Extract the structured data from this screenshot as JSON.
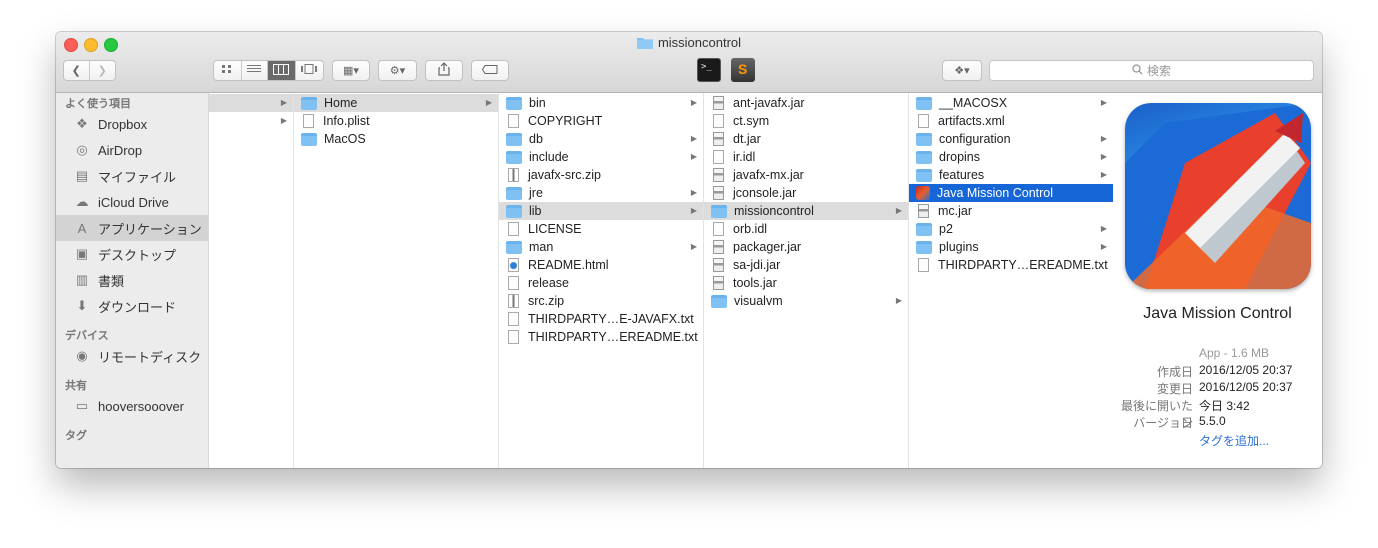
{
  "window": {
    "title": "missioncontrol"
  },
  "toolbar": {
    "search_placeholder": "検索",
    "back_icon": "chevron-left-icon",
    "forward_icon": "chevron-right-icon"
  },
  "sidebar": {
    "sections": [
      {
        "heading": "よく使う項目",
        "items": [
          {
            "label": "Dropbox",
            "icon": "dropbox-icon"
          },
          {
            "label": "AirDrop",
            "icon": "airdrop-icon"
          },
          {
            "label": "マイファイル",
            "icon": "all-files-icon"
          },
          {
            "label": "iCloud Drive",
            "icon": "cloud-icon"
          },
          {
            "label": "アプリケーション",
            "icon": "applications-icon",
            "selected": true
          },
          {
            "label": "デスクトップ",
            "icon": "desktop-icon"
          },
          {
            "label": "書類",
            "icon": "documents-icon"
          },
          {
            "label": "ダウンロード",
            "icon": "downloads-icon"
          }
        ]
      },
      {
        "heading": "デバイス",
        "items": [
          {
            "label": "リモートディスク",
            "icon": "disc-icon"
          }
        ]
      },
      {
        "heading": "共有",
        "items": [
          {
            "label": "hooversooover",
            "icon": "computer-icon"
          }
        ]
      },
      {
        "heading": "タグ",
        "items": []
      }
    ]
  },
  "columns": [
    {
      "items": [
        {
          "label": "",
          "type": "blank",
          "arrow": true,
          "path": true
        },
        {
          "label": "",
          "type": "blank",
          "arrow": true
        }
      ]
    },
    {
      "items": [
        {
          "label": "Home",
          "type": "folder",
          "arrow": true,
          "path": true
        },
        {
          "label": "Info.plist",
          "type": "file"
        },
        {
          "label": "MacOS",
          "type": "folder"
        }
      ]
    },
    {
      "items": [
        {
          "label": "bin",
          "type": "folder",
          "arrow": true
        },
        {
          "label": "COPYRIGHT",
          "type": "blank"
        },
        {
          "label": "db",
          "type": "folder",
          "arrow": true
        },
        {
          "label": "include",
          "type": "folder",
          "arrow": true
        },
        {
          "label": "javafx-src.zip",
          "type": "zip"
        },
        {
          "label": "jre",
          "type": "folder",
          "arrow": true
        },
        {
          "label": "lib",
          "type": "folder",
          "arrow": true,
          "path": true
        },
        {
          "label": "LICENSE",
          "type": "blank"
        },
        {
          "label": "man",
          "type": "folder",
          "arrow": true
        },
        {
          "label": "README.html",
          "type": "html"
        },
        {
          "label": "release",
          "type": "file"
        },
        {
          "label": "src.zip",
          "type": "zip"
        },
        {
          "label": "THIRDPARTY…E-JAVAFX.txt",
          "type": "file"
        },
        {
          "label": "THIRDPARTY…EREADME.txt",
          "type": "file"
        }
      ]
    },
    {
      "items": [
        {
          "label": "ant-javafx.jar",
          "type": "jar"
        },
        {
          "label": "ct.sym",
          "type": "blank"
        },
        {
          "label": "dt.jar",
          "type": "jar"
        },
        {
          "label": "ir.idl",
          "type": "file"
        },
        {
          "label": "javafx-mx.jar",
          "type": "jar"
        },
        {
          "label": "jconsole.jar",
          "type": "jar"
        },
        {
          "label": "missioncontrol",
          "type": "folder",
          "arrow": true,
          "path": true
        },
        {
          "label": "orb.idl",
          "type": "file"
        },
        {
          "label": "packager.jar",
          "type": "jar"
        },
        {
          "label": "sa-jdi.jar",
          "type": "jar"
        },
        {
          "label": "tools.jar",
          "type": "jar"
        },
        {
          "label": "visualvm",
          "type": "folder",
          "arrow": true
        }
      ]
    },
    {
      "items": [
        {
          "label": "__MACOSX",
          "type": "folder",
          "arrow": true
        },
        {
          "label": "artifacts.xml",
          "type": "blank"
        },
        {
          "label": "configuration",
          "type": "folder",
          "arrow": true
        },
        {
          "label": "dropins",
          "type": "folder",
          "arrow": true
        },
        {
          "label": "features",
          "type": "folder",
          "arrow": true
        },
        {
          "label": "Java Mission Control",
          "type": "app",
          "selected": true
        },
        {
          "label": "mc.jar",
          "type": "jar"
        },
        {
          "label": "p2",
          "type": "folder",
          "arrow": true
        },
        {
          "label": "plugins",
          "type": "folder",
          "arrow": true
        },
        {
          "label": "THIRDPARTY…EREADME.txt",
          "type": "file"
        }
      ]
    }
  ],
  "preview": {
    "name": "Java Mission Control",
    "kind": "App - 1.6 MB",
    "meta": [
      {
        "key": "作成日",
        "value": "2016/12/05 20:37"
      },
      {
        "key": "変更日",
        "value": "2016/12/05 20:37"
      },
      {
        "key": "最後に開いた日",
        "value": "今日 3:42"
      },
      {
        "key": "バージョン",
        "value": "5.5.0"
      }
    ],
    "add_tags": "タグを追加..."
  },
  "colors": {
    "selection": "#1766d8",
    "folder": "#7fc1f2",
    "link": "#2b6fd6"
  }
}
